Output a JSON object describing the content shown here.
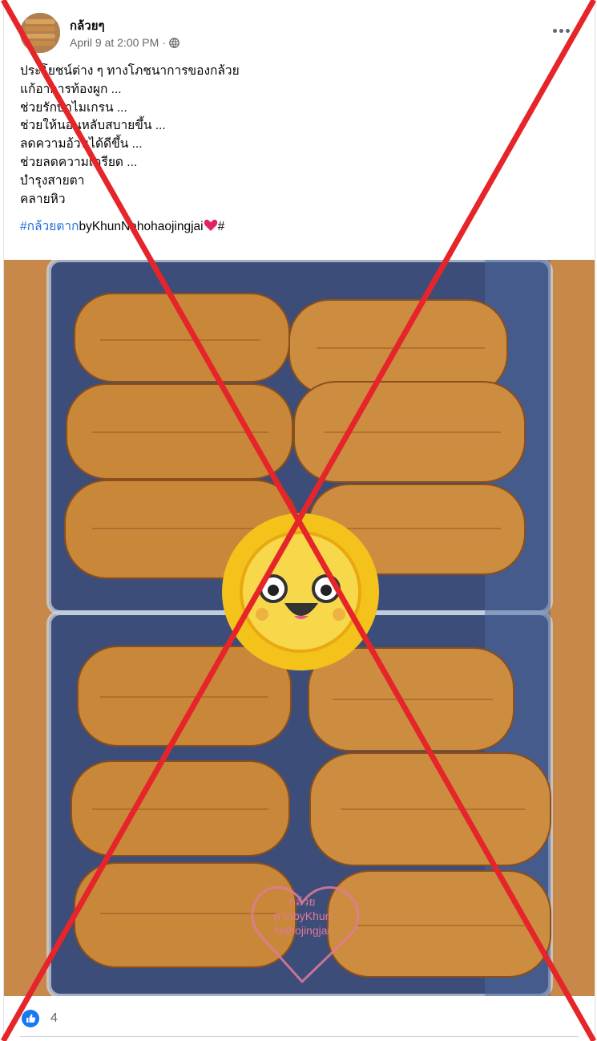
{
  "post": {
    "author": "กล้วยๆ",
    "timestamp": "April 9 at 2:00 PM",
    "privacy_icon": "globe-icon",
    "more_icon": "more-options-icon",
    "text_lines": [
      "ประโยชน์ต่าง ๆ ทางโภชนาการของกล้วย",
      "แก้อาการท้องผูก ...",
      "ช่วยรักษาไมเกรน ...",
      "ช่วยให้นอนหลับสบายขึ้น ...",
      "ลดความอ้วนได้ดีขึ้น ...",
      "ช่วยลดความเครียด ...",
      "บำรุงสายตา",
      "คลายหิว"
    ],
    "hashtag": "#กล้วยตาก",
    "hashtag_suffix": "byKhunNahohaojingjai",
    "hashtag_end": "#"
  },
  "photo": {
    "watermark_text": [
      "กล้วย",
      "ตากbyKhun",
      "Nahojingjai"
    ]
  },
  "reactions": {
    "icon": "like-icon",
    "count": "4"
  },
  "colors": {
    "brand_blue": "#1877f2",
    "hashtag": "#216fdb",
    "cross": "#e5252a",
    "photo_bg": "#c8884a"
  }
}
